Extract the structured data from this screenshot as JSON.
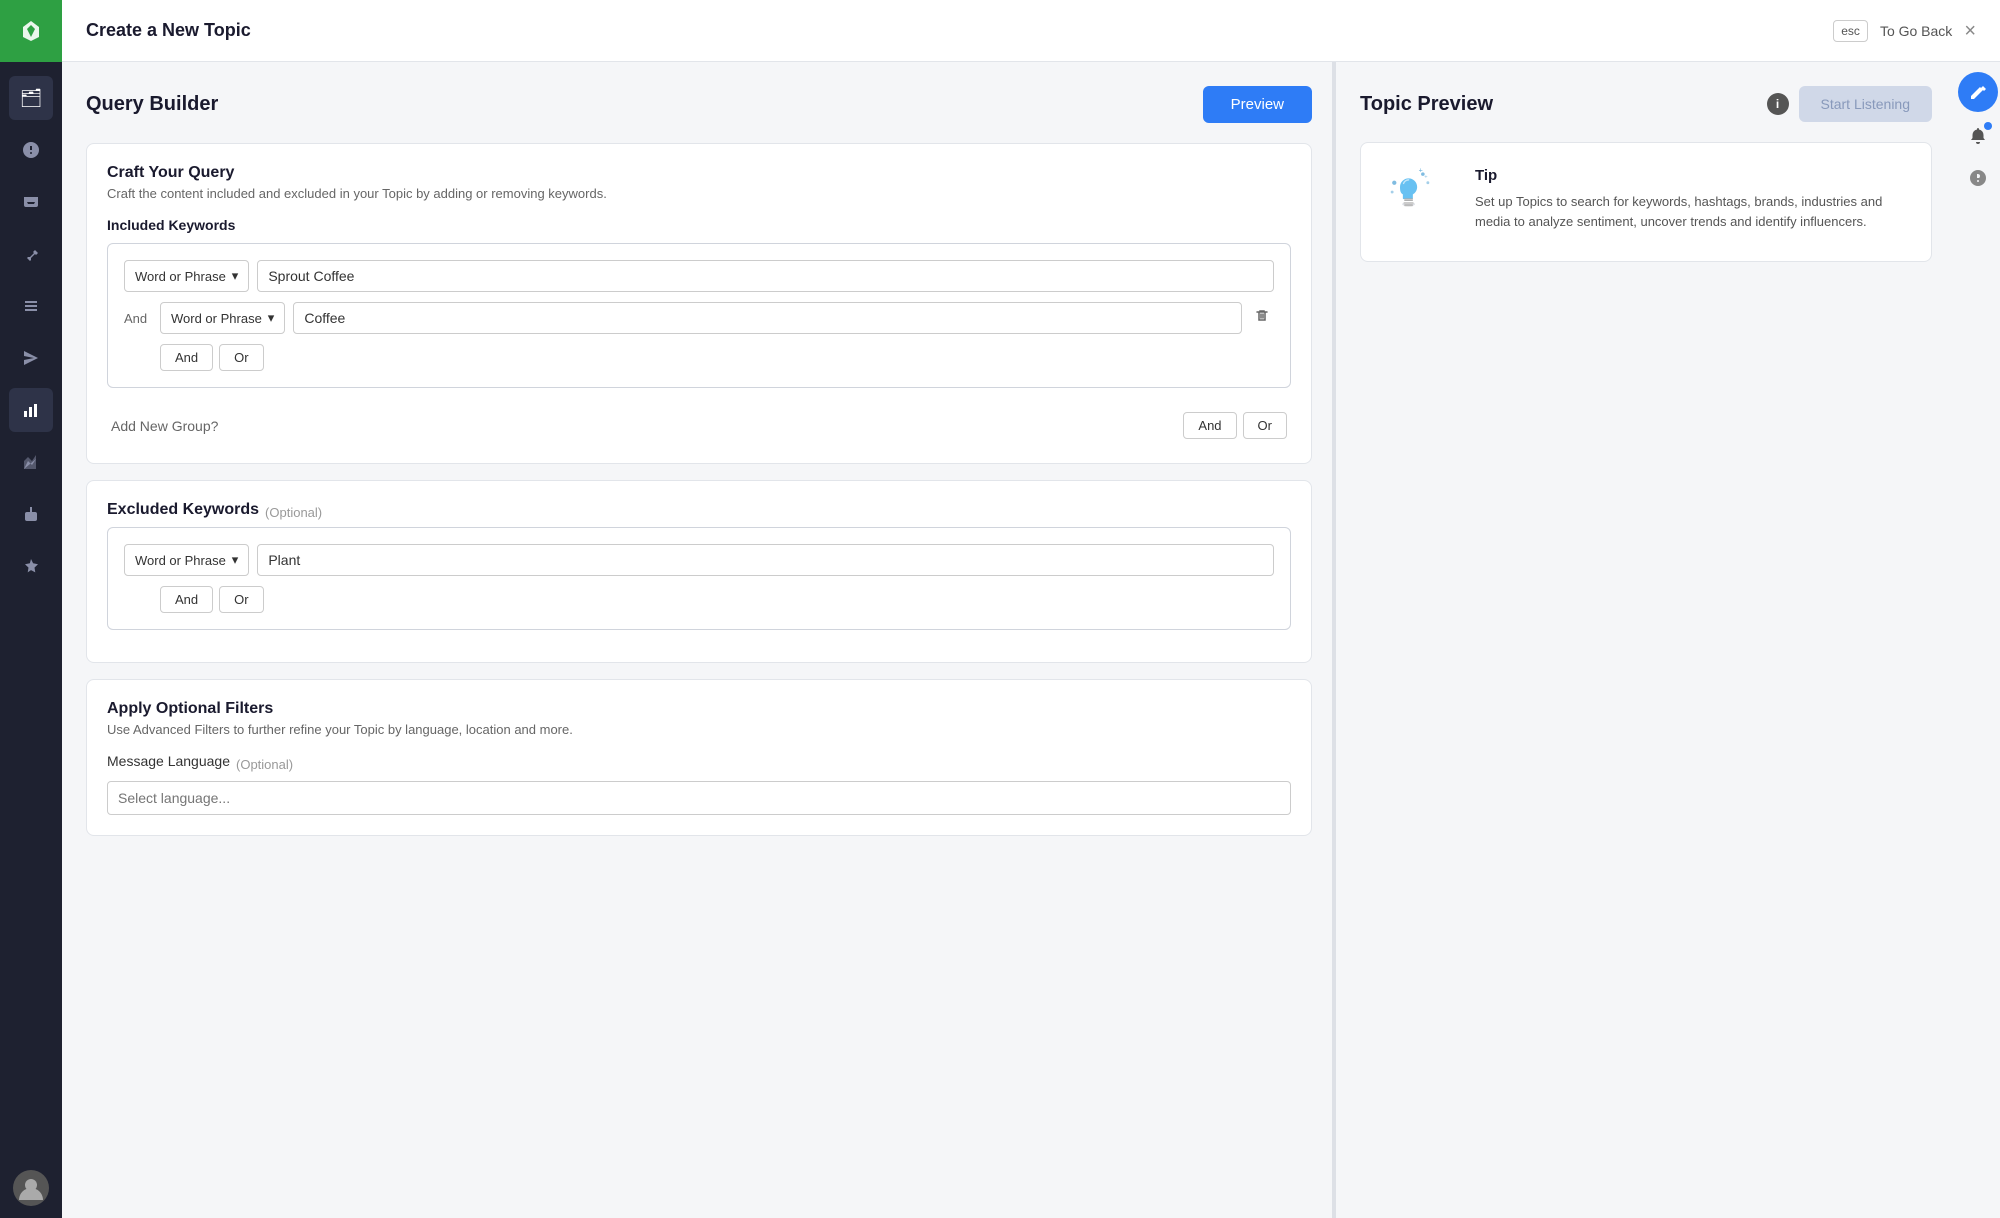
{
  "topbar": {
    "title": "Create a New Topic",
    "esc_label": "esc",
    "go_back_label": "To Go Back",
    "close_label": "×"
  },
  "left_panel": {
    "title": "Query Builder",
    "preview_btn": "Preview",
    "craft": {
      "title": "Craft Your Query",
      "subtitle": "Craft the content included and excluded in your Topic by adding or removing keywords.",
      "included_section": {
        "title": "Included Keywords",
        "group": {
          "first_row": {
            "type": "Word or Phrase",
            "value": "Sprout Coffee"
          },
          "second_row": {
            "label": "And",
            "type": "Word or Phrase",
            "value": "Coffee"
          },
          "and_btn": "And",
          "or_btn": "Or"
        },
        "add_group_label": "Add New Group?",
        "add_and_btn": "And",
        "add_or_btn": "Or"
      },
      "excluded_section": {
        "title": "Excluded Keywords",
        "optional": "(Optional)",
        "group": {
          "first_row": {
            "type": "Word or Phrase",
            "value": "Plant"
          },
          "and_btn": "And",
          "or_btn": "Or"
        }
      }
    },
    "filters": {
      "title": "Apply Optional Filters",
      "subtitle": "Use Advanced Filters to further refine your Topic by language, location and more.",
      "message_language_label": "Message Language",
      "optional": "(Optional)"
    }
  },
  "right_panel": {
    "title": "Topic Preview",
    "start_listening_btn": "Start Listening",
    "tip": {
      "label": "Tip",
      "text": "Set up Topics to search for keywords, hashtags, brands, industries and media to analyze sentiment, uncover trends and identify influencers."
    }
  },
  "sidebar": {
    "icons": [
      {
        "name": "folder-icon",
        "symbol": "🗂",
        "active": true
      },
      {
        "name": "alert-icon",
        "symbol": "⚠"
      },
      {
        "name": "inbox-icon",
        "symbol": "📥"
      },
      {
        "name": "pin-icon",
        "symbol": "📌"
      },
      {
        "name": "list-icon",
        "symbol": "☰"
      },
      {
        "name": "send-icon",
        "symbol": "✉"
      },
      {
        "name": "chart-icon",
        "symbol": "📊",
        "active": true
      },
      {
        "name": "bar-chart-icon",
        "symbol": "📈"
      },
      {
        "name": "bot-icon",
        "symbol": "🤖"
      },
      {
        "name": "star-icon",
        "symbol": "⭐"
      }
    ]
  }
}
